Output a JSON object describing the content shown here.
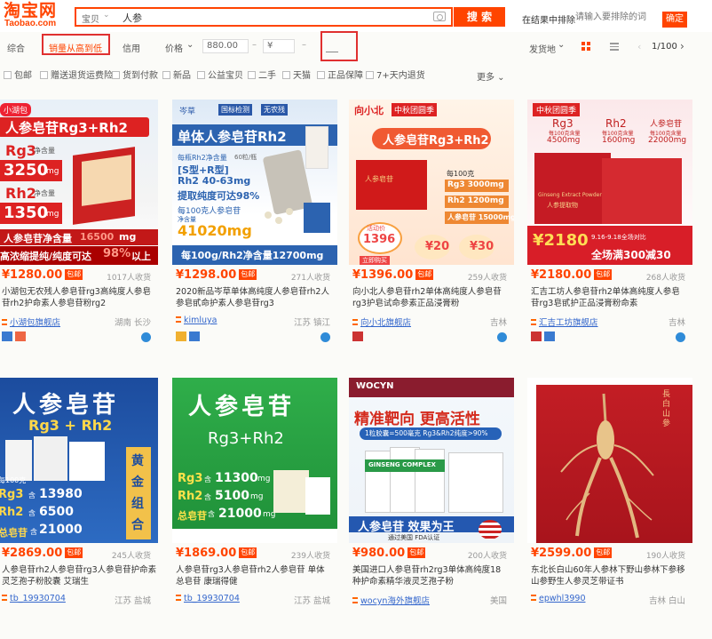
{
  "header": {
    "logo_cn": "淘宝网",
    "logo_en": "Taobao.com",
    "search_type": "宝贝",
    "search_query": "人参",
    "search_button": "搜 索",
    "within_label": "在结果中排除",
    "within_placeholder": "请输入要排除的词",
    "within_button": "确定"
  },
  "sort_bar": {
    "items": [
      "综合",
      "销量从高到低",
      "信用",
      "价格"
    ],
    "active": "销量从高到低",
    "price_min": "880.00",
    "price_max": "¥",
    "shipping": "发货地",
    "page": "1/100"
  },
  "filters": [
    "包邮",
    "赠送退货运费险",
    "货到付款",
    "新品",
    "公益宝贝",
    "二手",
    "天猫",
    "正品保障",
    "7+天内退货"
  ],
  "more_label": "更多",
  "colors": {
    "accent": "#ff4400",
    "link": "#3366cc"
  },
  "products": [
    {
      "price": "¥1280.00",
      "tag": "包邮",
      "sales": "1017人收货",
      "title": "小湖包无农残人参皂苷rg3高纯度人参皂苷rh2护命素人参皂苷粉rg2",
      "shop": "小湖包旗舰店",
      "location": "湖南 长沙",
      "img": {
        "brand": "小湖包",
        "headline": "人参皂苷Rg3+Rh2",
        "l1": "Rg3",
        "l1s": "净含量",
        "v1": "3250",
        "u1": "mg",
        "l2": "Rh2",
        "l2s": "净含量",
        "v2": "1350",
        "u2": "mg",
        "b1a": "人参皂苷净含量",
        "b1b": "16500",
        "b1c": "mg",
        "b2a": "高浓缩提纯/纯度可达",
        "b2b": "98%",
        "b2c": "以上"
      }
    },
    {
      "price": "¥1298.00",
      "tag": "包邮",
      "sales": "271人收货",
      "title": "2020新品岑草单体高纯度人参皂苷rh2人参皂甙命护素人参皂苷rg3",
      "shop": "kimluya",
      "location": "江苏 镇江",
      "img": {
        "brand": "岑草",
        "b1": "国标检测",
        "b2": "无农残",
        "headline": "单体人参皂苷Rh2",
        "s1": "每瓶Rh2净含量",
        "s1b": "60粒/瓶",
        "s2": "[S型+R型]",
        "s3": "Rh2 40-63mg",
        "s4": "提取纯度可达98%",
        "s5": "每100克人参皂苷",
        "s5b": "净含量",
        "big": "41020mg",
        "bottom": "每100g/Rh2净含量12700mg"
      }
    },
    {
      "price": "¥1396.00",
      "tag": "包邮",
      "sales": "259人收货",
      "title": "向小北人参皂苷rh2单体高纯度人参皂苷rg3护皂试命参素正品浸膏粉",
      "shop": "向小北旗舰店",
      "location": "吉林",
      "img": {
        "brand": "向小北",
        "brand2": "中秋团圆季",
        "headline": "人参皂苷Rg3+Rh2",
        "box": "人参皂苷",
        "per": "每100克",
        "r1": "Rg3",
        "r1v": "3000",
        "r2": "Rh2",
        "r2v": "1200",
        "r3": "人参皂苷",
        "r3v": "15000",
        "unit": "mg",
        "seal": "1396",
        "seal_top": "活动价",
        "coupon1": "20",
        "coupon2": "30",
        "coupon_sym": "¥",
        "buy": "立即购买"
      }
    },
    {
      "price": "¥2180.00",
      "tag": "包邮",
      "sales": "268人收货",
      "title": "汇吉工坊人参皂苷rh2单体高纯度人参皂苷rg3皂甙护正品浸膏粉命素",
      "shop": "汇吉工坊旗舰店",
      "location": "吉林",
      "img": {
        "brand": "中秋团圆季",
        "c1": "Rg3",
        "c1s": "每100克含量",
        "c1v": "4500mg",
        "c2": "Rh2",
        "c2s": "每100克含量",
        "c2v": "1600mg",
        "c3": "人参皂苷",
        "c3s": "每100克含量",
        "c3v": "22000mg",
        "pkg": "Ginseng Extract Powder",
        "pkg2": "人参提取物",
        "big": "¥2180",
        "date": "9.16-9.18全场对比",
        "bottom": "全场满300减30"
      }
    },
    {
      "price": "¥2869.00",
      "tag": "包邮",
      "sales": "245人收货",
      "title": "人参皂苷rh2人参皂苷rg3人参皂苷护命素灵芝孢子粉胶囊 艾瑞生",
      "shop": "tb_19930704",
      "location": "江苏 盐城",
      "img": {
        "headline": "人参皂苷",
        "sub": "Rg3 + Rh2",
        "per": "每100克",
        "l1": "Rg3",
        "v1": "13980",
        "l2": "Rh2",
        "v2": "6500",
        "l3": "总皂苷",
        "v3": "21000",
        "side": "黄金组合",
        "sym": "含"
      }
    },
    {
      "price": "¥1869.00",
      "tag": "包邮",
      "sales": "239人收货",
      "title": "人参皂苷rg3人参皂苷rh2人参皂苷 单体总皂苷 康瑞得健",
      "shop": "tb_19930704",
      "location": "江苏 盐城",
      "img": {
        "headline": "人参皂苷",
        "sub": "Rg3+Rh2",
        "l1": "Rg3",
        "v1": "11300",
        "l2": "Rh2",
        "v2": "5100",
        "l3": "总皂苷",
        "v3": "21000",
        "sym": "含",
        "unit": "mg"
      }
    },
    {
      "price": "¥980.00",
      "tag": "包邮",
      "sales": "200人收货",
      "title": "美国进口人参皂苷rh2rg3单体高纯度18种护命素精华液灵芝孢子粉",
      "shop": "wocyn海外旗舰店",
      "location": "美国",
      "img": {
        "brand": "WOCYN",
        "headline": "精准靶向 更高活性",
        "sub": "1粒胶囊=500毫克 Rg3&Rh2纯度>90%",
        "box": "GINSENG COMPLEX",
        "bottom": "人参皂苷 效果为王",
        "bottom2": "通过美国 FDA认证"
      }
    },
    {
      "price": "¥2599.00",
      "tag": "包邮",
      "sales": "190人收货",
      "title": "东北长白山60年人参林下野山参林下参移山参野生人参灵芝带证书",
      "shop": "epwhl3990",
      "location": "吉林 白山",
      "img": {
        "seal": "長白山參"
      }
    }
  ]
}
